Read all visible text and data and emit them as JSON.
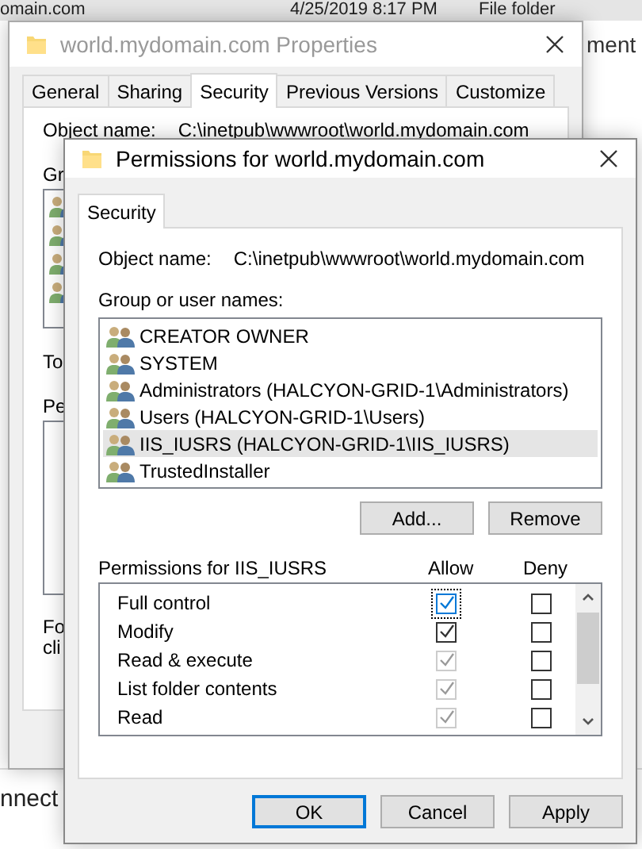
{
  "background_window": {
    "file_row": {
      "name": "omain.com",
      "date": "4/25/2019 8:17 PM",
      "type": "File folder"
    },
    "right_text": "ment",
    "bottom_text": "nnect"
  },
  "properties_window": {
    "title": "world.mydomain.com Properties",
    "tabs": [
      {
        "label": "General",
        "selected": false
      },
      {
        "label": "Sharing",
        "selected": false
      },
      {
        "label": "Security",
        "selected": true
      },
      {
        "label": "Previous Versions",
        "selected": false
      },
      {
        "label": "Customize",
        "selected": false
      }
    ],
    "object_label": "Object name:",
    "object_value": "C:\\inetpub\\wwwroot\\world.mydomain.com",
    "partial_labels": [
      "Gr",
      "To",
      "Pe"
    ],
    "partial_note": [
      "Fo",
      "cli"
    ]
  },
  "permissions_dialog": {
    "title": "Permissions for world.mydomain.com",
    "tabs": [
      {
        "label": "Security",
        "selected": true
      }
    ],
    "object_label": "Object name:",
    "object_value": "C:\\inetpub\\wwwroot\\world.mydomain.com",
    "group_label": "Group or user names:",
    "users": [
      {
        "name": "CREATOR OWNER",
        "selected": false
      },
      {
        "name": "SYSTEM",
        "selected": false
      },
      {
        "name": "Administrators (HALCYON-GRID-1\\Administrators)",
        "selected": false
      },
      {
        "name": "Users (HALCYON-GRID-1\\Users)",
        "selected": false
      },
      {
        "name": "IIS_IUSRS (HALCYON-GRID-1\\IIS_IUSRS)",
        "selected": true
      },
      {
        "name": "TrustedInstaller",
        "selected": false
      }
    ],
    "user_buttons": [
      "Add...",
      "Remove"
    ],
    "permissions_label": "Permissions for IIS_IUSRS",
    "columns": [
      "Allow",
      "Deny"
    ],
    "permissions": [
      {
        "name": "Full control",
        "allow": {
          "checked": true,
          "disabled": false,
          "focused": true
        },
        "deny": {
          "checked": false,
          "disabled": false,
          "focused": false
        }
      },
      {
        "name": "Modify",
        "allow": {
          "checked": true,
          "disabled": false,
          "focused": false
        },
        "deny": {
          "checked": false,
          "disabled": false,
          "focused": false
        }
      },
      {
        "name": "Read & execute",
        "allow": {
          "checked": true,
          "disabled": true,
          "focused": false
        },
        "deny": {
          "checked": false,
          "disabled": false,
          "focused": false
        }
      },
      {
        "name": "List folder contents",
        "allow": {
          "checked": true,
          "disabled": true,
          "focused": false
        },
        "deny": {
          "checked": false,
          "disabled": false,
          "focused": false
        }
      },
      {
        "name": "Read",
        "allow": {
          "checked": true,
          "disabled": true,
          "focused": false
        },
        "deny": {
          "checked": false,
          "disabled": false,
          "focused": false
        }
      }
    ],
    "buttons": [
      {
        "label": "OK",
        "default": true
      },
      {
        "label": "Cancel",
        "default": false
      },
      {
        "label": "Apply",
        "default": false
      }
    ]
  }
}
